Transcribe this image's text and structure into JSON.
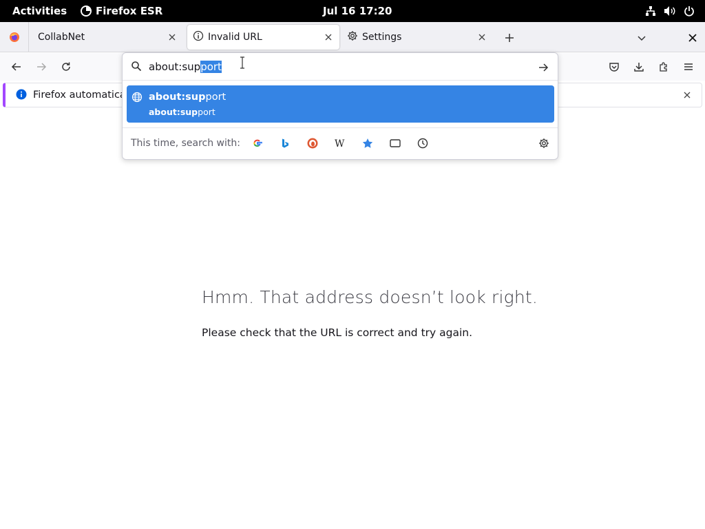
{
  "topbar": {
    "activities": "Activities",
    "app_name": "Firefox ESR",
    "datetime": "Jul 16  17:20",
    "system_icons": [
      "network-icon",
      "volume-icon",
      "power-icon"
    ]
  },
  "tabs": [
    {
      "label": "CollabNet",
      "active": false,
      "icon": "none"
    },
    {
      "label": "Invalid URL",
      "active": true,
      "icon": "info-icon"
    },
    {
      "label": "Settings",
      "active": false,
      "icon": "gear-icon"
    }
  ],
  "urlbar": {
    "typed": "about:sup",
    "autocompleted": "port"
  },
  "suggestion": {
    "title_bold": "about:sup",
    "title_rest": "port",
    "url_bold": "about:sup",
    "url_rest": "port"
  },
  "search_with": {
    "label": "This time, search with:",
    "engines": [
      "google",
      "bing",
      "duckduckgo",
      "wikipedia",
      "bookmarks",
      "tabs",
      "history"
    ]
  },
  "notification": {
    "text": "Firefox automatically"
  },
  "page": {
    "title": "Hmm. That address doesn’t look right.",
    "description": "Please check that the URL is correct and try again."
  },
  "colors": {
    "accent": "#3584e4",
    "notification_border": "#a347ff"
  }
}
